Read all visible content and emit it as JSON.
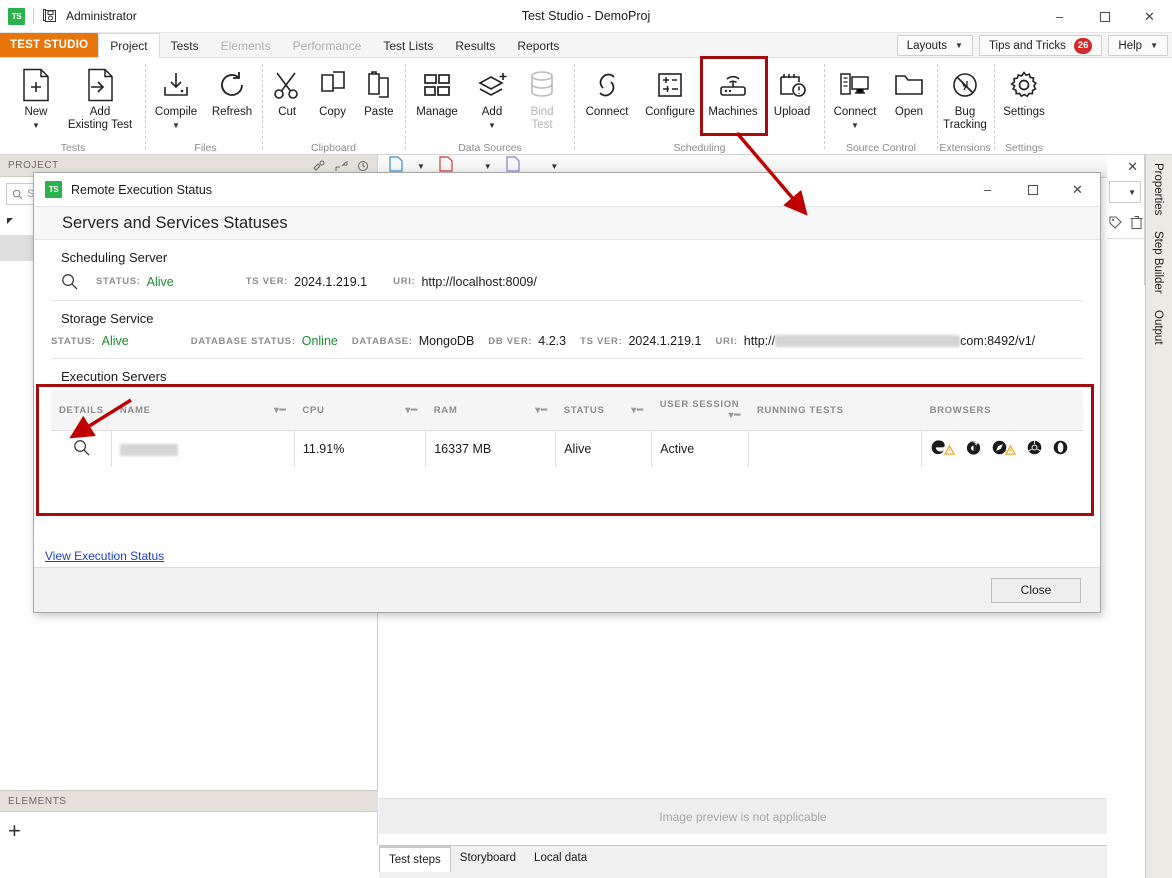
{
  "window": {
    "user": "Administrator",
    "title": "Test Studio - DemoProj",
    "minimize": "–",
    "maximize": "▫",
    "close": "✕",
    "logo_text": "TS"
  },
  "ribbon": {
    "brand_tab": "TEST STUDIO",
    "tabs": [
      {
        "label": "Project",
        "state": "active"
      },
      {
        "label": "Tests",
        "state": "normal"
      },
      {
        "label": "Elements",
        "state": "disabled"
      },
      {
        "label": "Performance",
        "state": "disabled"
      },
      {
        "label": "Test Lists",
        "state": "normal"
      },
      {
        "label": "Results",
        "state": "normal"
      },
      {
        "label": "Reports",
        "state": "normal"
      }
    ],
    "right_controls": {
      "layouts": "Layouts",
      "tips": "Tips and Tricks",
      "tips_badge": "26",
      "help": "Help"
    },
    "groups": [
      {
        "label": "Tests",
        "items": [
          {
            "label": "New",
            "icon": "new-file-icon",
            "dropdown": true,
            "disabled": false
          },
          {
            "label": "Add\nExisting Test",
            "icon": "add-existing-test-icon",
            "dropdown": false,
            "disabled": false
          }
        ]
      },
      {
        "label": "Files",
        "items": [
          {
            "label": "Compile",
            "icon": "compile-icon",
            "dropdown": true,
            "disabled": false
          },
          {
            "label": "Refresh",
            "icon": "refresh-icon",
            "dropdown": false,
            "disabled": false
          }
        ]
      },
      {
        "label": "Clipboard",
        "items": [
          {
            "label": "Cut",
            "icon": "scissors-icon",
            "dropdown": false,
            "disabled": false
          },
          {
            "label": "Copy",
            "icon": "copy-icon",
            "dropdown": false,
            "disabled": false
          },
          {
            "label": "Paste",
            "icon": "paste-icon",
            "dropdown": false,
            "disabled": false
          }
        ]
      },
      {
        "label": "Data Sources",
        "items": [
          {
            "label": "Manage",
            "icon": "manage-icon",
            "dropdown": false,
            "disabled": false
          },
          {
            "label": "Add",
            "icon": "add-layers-icon",
            "dropdown": true,
            "disabled": false
          },
          {
            "label": "Bind\nTest",
            "icon": "database-icon",
            "dropdown": false,
            "disabled": true
          }
        ]
      },
      {
        "label": "Scheduling",
        "items": [
          {
            "label": "Connect",
            "icon": "link-icon",
            "dropdown": false,
            "disabled": false
          },
          {
            "label": "Configure",
            "icon": "configure-icon",
            "dropdown": false,
            "disabled": false
          },
          {
            "label": "Machines",
            "icon": "router-icon",
            "dropdown": false,
            "disabled": false,
            "highlighted": true
          },
          {
            "label": "Upload",
            "icon": "upload-icon",
            "dropdown": false,
            "disabled": false
          }
        ]
      },
      {
        "label": "Source Control",
        "items": [
          {
            "label": "Connect",
            "icon": "source-control-connect-icon",
            "dropdown": true,
            "disabled": false
          },
          {
            "label": "Open",
            "icon": "folder-icon",
            "dropdown": false,
            "disabled": false
          }
        ]
      },
      {
        "label": "Extensions",
        "items": [
          {
            "label": "Bug\nTracking",
            "icon": "bug-tracking-icon",
            "dropdown": false,
            "disabled": false
          }
        ]
      },
      {
        "label": "Settings",
        "items": [
          {
            "label": "Settings",
            "icon": "gear-icon",
            "dropdown": false,
            "disabled": false
          }
        ]
      }
    ]
  },
  "left_panel": {
    "header": "PROJECT",
    "search_placeholder": "Search",
    "elements_header": "ELEMENTS"
  },
  "center_panel": {
    "preview_message": "Image preview is not applicable",
    "tabs": [
      {
        "label": "Test steps",
        "active": true
      },
      {
        "label": "Storyboard",
        "active": false
      },
      {
        "label": "Local data",
        "active": false
      }
    ]
  },
  "right_panel": {
    "vertical_tabs": [
      "Properties",
      "Step Builder",
      "Output"
    ]
  },
  "dialog": {
    "title": "Remote Execution Status",
    "minimize": "–",
    "maximize": "▫",
    "close": "✕",
    "heading": "Servers and Services Statuses",
    "scheduling_server": {
      "section_title": "Scheduling Server",
      "status_label": "STATUS:",
      "status_value": "Alive",
      "ts_ver_label": "TS VER:",
      "ts_ver_value": "2024.1.219.1",
      "uri_label": "URI:",
      "uri_value": "http://localhost:8009/"
    },
    "storage_service": {
      "section_title": "Storage Service",
      "status_label": "STATUS:",
      "status_value": "Alive",
      "database_status_label": "DATABASE STATUS:",
      "database_status_value": "Online",
      "database_label": "DATABASE:",
      "database_value": "MongoDB",
      "db_ver_label": "DB VER:",
      "db_ver_value": "4.2.3",
      "ts_ver_label": "TS VER:",
      "ts_ver_value": "2024.1.219.1",
      "uri_label": "URI:",
      "uri_prefix": "http://",
      "uri_redacted": true,
      "uri_suffix": "com:8492/v1/"
    },
    "execution_servers": {
      "section_title": "Execution Servers",
      "columns": [
        {
          "label": "DETAILS",
          "filter": false
        },
        {
          "label": "NAME",
          "filter": true
        },
        {
          "label": "CPU",
          "filter": true
        },
        {
          "label": "RAM",
          "filter": true
        },
        {
          "label": "STATUS",
          "filter": true
        },
        {
          "label": "USER SESSION",
          "filter": true
        },
        {
          "label": "RUNNING TESTS",
          "filter": false
        },
        {
          "label": "BROWSERS",
          "filter": false
        }
      ],
      "rows": [
        {
          "details_icon": "magnifier-icon",
          "name": "",
          "name_redacted": true,
          "cpu": "11.91%",
          "ram": "16337 MB",
          "status": "Alive",
          "user_session": "Active",
          "running_tests": "",
          "browsers": [
            {
              "icon": "edge-icon",
              "warning": true
            },
            {
              "icon": "firefox-icon",
              "warning": false
            },
            {
              "icon": "safari-icon",
              "warning": true
            },
            {
              "icon": "chrome-icon",
              "warning": false
            },
            {
              "icon": "opera-icon",
              "warning": false
            }
          ]
        }
      ]
    },
    "view_execution_status_link": "View Execution Status",
    "close_button": "Close"
  },
  "annotations": {
    "highlight_color": "#a30d0d",
    "arrow_color": "#c00000"
  }
}
